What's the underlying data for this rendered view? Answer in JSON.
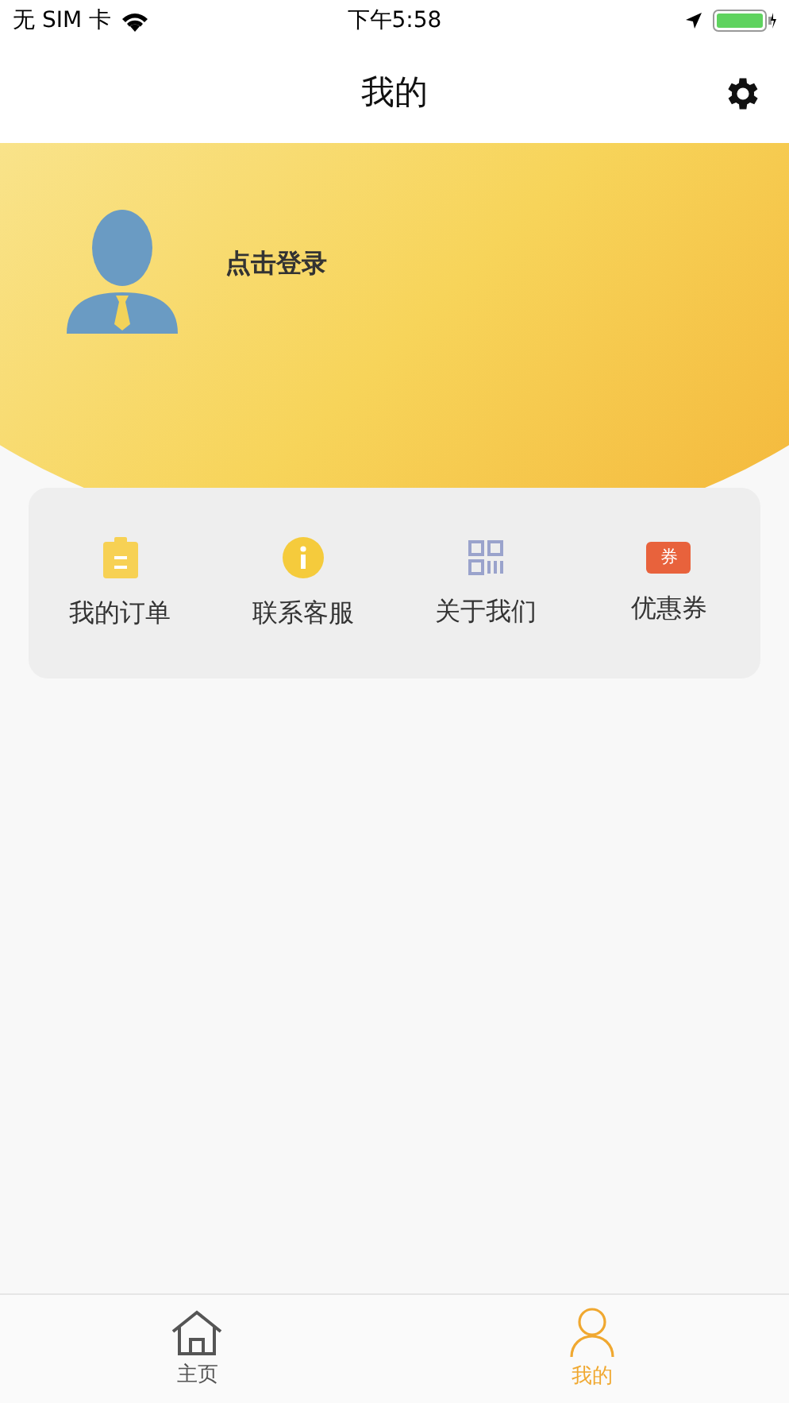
{
  "status_bar": {
    "carrier": "无 SIM 卡",
    "time": "下午5:58"
  },
  "nav": {
    "title": "我的"
  },
  "profile": {
    "login": "点击登录"
  },
  "menu": [
    {
      "kind": "order",
      "label": "我的订单"
    },
    {
      "kind": "info",
      "label": "联系客服"
    },
    {
      "kind": "about",
      "label": "关于我们"
    },
    {
      "kind": "coupon",
      "label": "优惠券",
      "badge": "券"
    }
  ],
  "tab_bar": [
    {
      "kind": "home",
      "label": "主页",
      "selected": false
    },
    {
      "kind": "user",
      "label": "我的",
      "selected": true
    }
  ]
}
